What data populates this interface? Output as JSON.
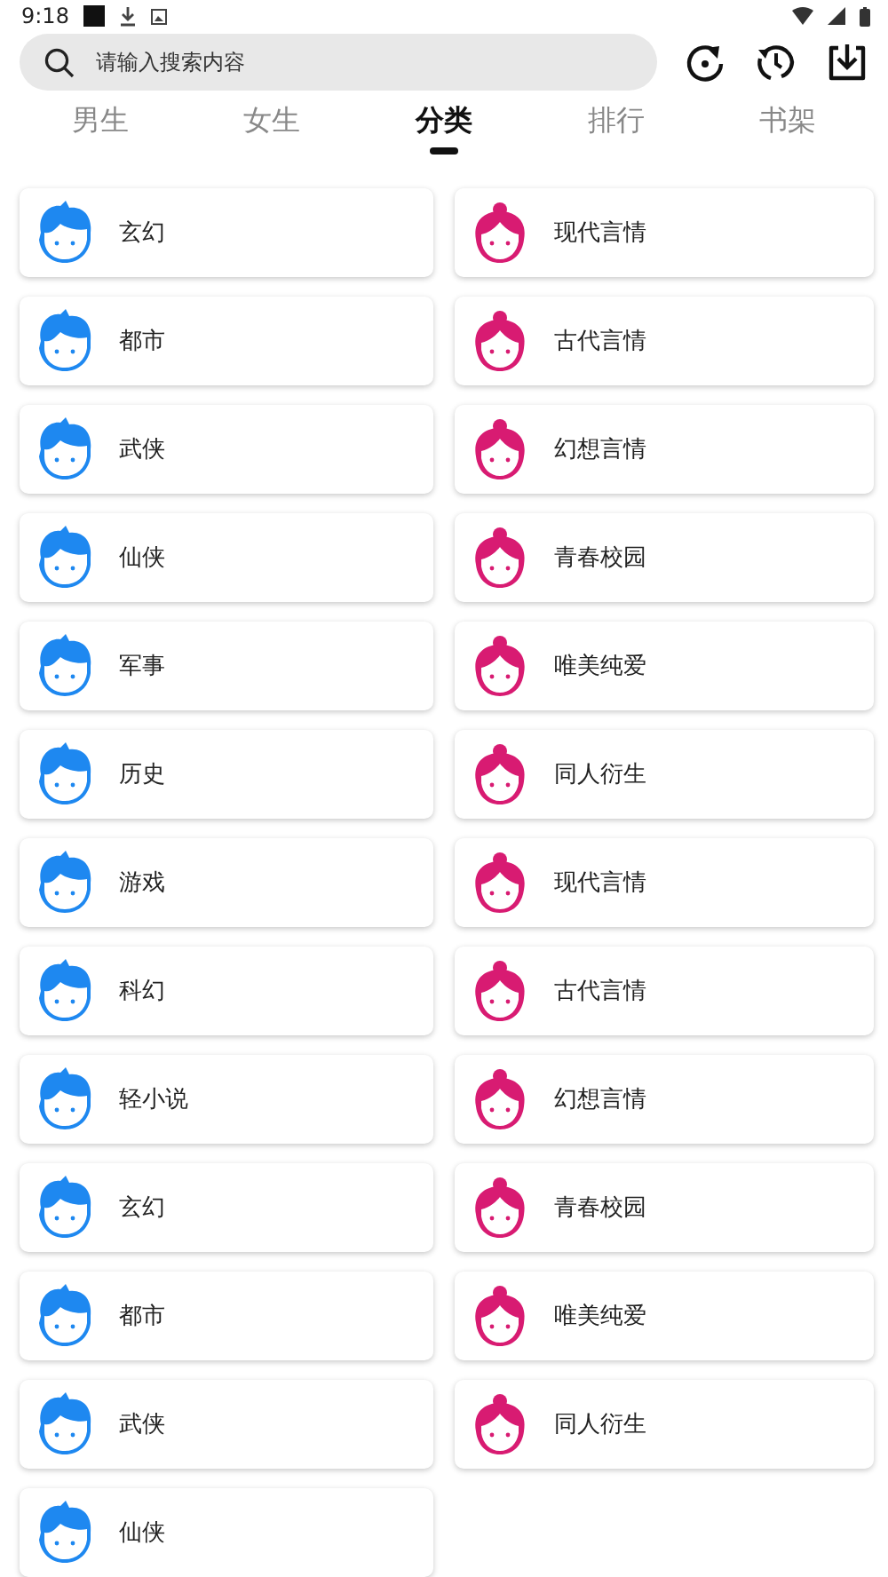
{
  "status_bar": {
    "time": "9:18"
  },
  "search": {
    "placeholder": "请输入搜索内容"
  },
  "tabs": [
    {
      "label": "男生",
      "selected": false
    },
    {
      "label": "女生",
      "selected": false
    },
    {
      "label": "分类",
      "selected": true
    },
    {
      "label": "排行",
      "selected": false
    },
    {
      "label": "书架",
      "selected": false
    }
  ],
  "categories": [
    {
      "label": "玄幻",
      "kind": "male"
    },
    {
      "label": "现代言情",
      "kind": "female"
    },
    {
      "label": "都市",
      "kind": "male"
    },
    {
      "label": "古代言情",
      "kind": "female"
    },
    {
      "label": "武侠",
      "kind": "male"
    },
    {
      "label": "幻想言情",
      "kind": "female"
    },
    {
      "label": "仙侠",
      "kind": "male"
    },
    {
      "label": "青春校园",
      "kind": "female"
    },
    {
      "label": "军事",
      "kind": "male"
    },
    {
      "label": "唯美纯爱",
      "kind": "female"
    },
    {
      "label": "历史",
      "kind": "male"
    },
    {
      "label": "同人衍生",
      "kind": "female"
    },
    {
      "label": "游戏",
      "kind": "male"
    },
    {
      "label": "现代言情",
      "kind": "female"
    },
    {
      "label": "科幻",
      "kind": "male"
    },
    {
      "label": "古代言情",
      "kind": "female"
    },
    {
      "label": "轻小说",
      "kind": "male"
    },
    {
      "label": "幻想言情",
      "kind": "female"
    },
    {
      "label": "玄幻",
      "kind": "male"
    },
    {
      "label": "青春校园",
      "kind": "female"
    },
    {
      "label": "都市",
      "kind": "male"
    },
    {
      "label": "唯美纯爱",
      "kind": "female"
    },
    {
      "label": "武侠",
      "kind": "male"
    },
    {
      "label": "同人衍生",
      "kind": "female"
    },
    {
      "label": "仙侠",
      "kind": "male"
    }
  ]
}
